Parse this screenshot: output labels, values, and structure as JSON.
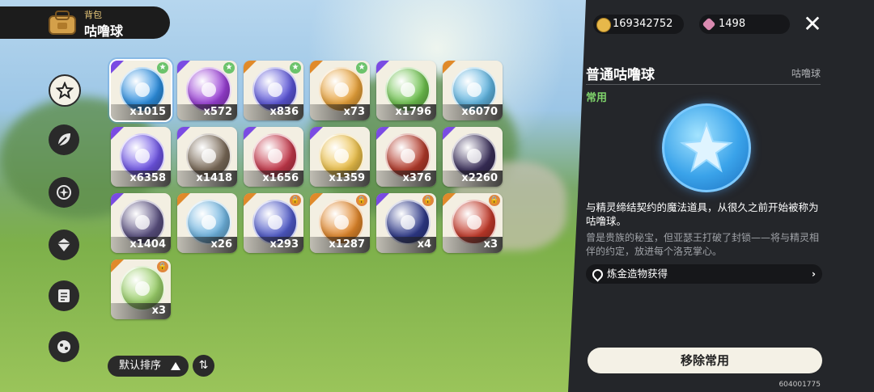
{
  "header": {
    "sub_title": "背包",
    "title": "咕噜球"
  },
  "nav": [
    "star-badge-icon",
    "leaf-icon",
    "spark-icon",
    "gem-icon",
    "scroll-icon",
    "ball-icon"
  ],
  "items": [
    {
      "qty": "x1015",
      "color": "#2d8fe0",
      "rarity": "#7a4be3",
      "badge": "fav",
      "selected": true
    },
    {
      "qty": "x572",
      "color": "#9a3fd6",
      "rarity": "#7a4be3",
      "badge": "fav"
    },
    {
      "qty": "x836",
      "color": "#5b55d8",
      "rarity": "#e08a2a",
      "badge": "fav"
    },
    {
      "qty": "x73",
      "color": "#e8a23a",
      "rarity": "#e08a2a",
      "badge": "fav"
    },
    {
      "qty": "x1796",
      "color": "#6ec24e",
      "rarity": "#7a4be3",
      "badge": ""
    },
    {
      "qty": "x6070",
      "color": "#5fb4e0",
      "rarity": "#e08a2a",
      "badge": ""
    },
    {
      "qty": "x6358",
      "color": "#6f55e6",
      "rarity": "#7a4be3",
      "badge": ""
    },
    {
      "qty": "x1418",
      "color": "#7a6a58",
      "rarity": "#7a4be3",
      "badge": ""
    },
    {
      "qty": "x1656",
      "color": "#c4384a",
      "rarity": "#7a4be3",
      "badge": ""
    },
    {
      "qty": "x1359",
      "color": "#ecc04a",
      "rarity": "#7a4be3",
      "badge": ""
    },
    {
      "qty": "x376",
      "color": "#b33a2a",
      "rarity": "#7a4be3",
      "badge": ""
    },
    {
      "qty": "x2260",
      "color": "#3a2f5a",
      "rarity": "#7a4be3",
      "badge": ""
    },
    {
      "qty": "x1404",
      "color": "#5a5080",
      "rarity": "#7a4be3",
      "badge": ""
    },
    {
      "qty": "x26",
      "color": "#6fb4e0",
      "rarity": "#e08a2a",
      "badge": ""
    },
    {
      "qty": "x293",
      "color": "#4f5ac8",
      "rarity": "#e08a2a",
      "badge": "lock"
    },
    {
      "qty": "x1287",
      "color": "#e0862a",
      "rarity": "#e08a2a",
      "badge": "lock"
    },
    {
      "qty": "x4",
      "color": "#2f3a8a",
      "rarity": "#7a4be3",
      "badge": "lock"
    },
    {
      "qty": "x3",
      "color": "#c33a2a",
      "rarity": "#e08a2a",
      "badge": "lock"
    },
    {
      "qty": "x3",
      "color": "#9bd06a",
      "rarity": "#e08a2a",
      "badge": "lock"
    }
  ],
  "sort": {
    "label": "默认排序",
    "toggle_icon": "⇅"
  },
  "currency": {
    "coins": "169342752",
    "gems": "1498"
  },
  "detail": {
    "name": "普通咕噜球",
    "category": "咕噜球",
    "tag": "常用",
    "description": "与精灵缔结契约的魔法道具，从很久之前开始被称为咕噜球。",
    "lore": "曾是贵族的秘宝，但亚瑟王打破了封锁——将与精灵相伴的约定，放进每个洛克掌心。",
    "source": "炼金造物获得",
    "remove_button": "移除常用"
  },
  "uid": "604001775",
  "colors": {
    "panel": "#24262a",
    "accent_green": "#7fd36b",
    "coin": "#e7b84a",
    "gem": "#d98ab0"
  }
}
